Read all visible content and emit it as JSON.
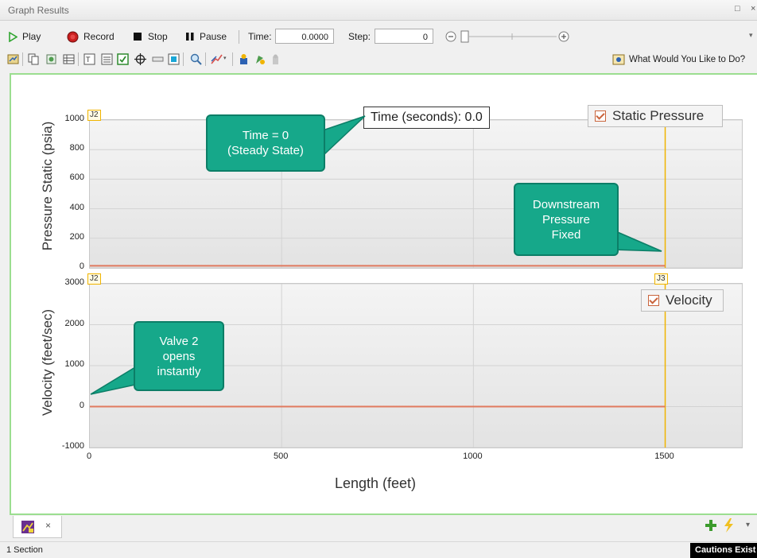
{
  "window": {
    "title": "Graph Results"
  },
  "player": {
    "play_label": "Play",
    "record_label": "Record",
    "stop_label": "Stop",
    "pause_label": "Pause",
    "time_label": "Time:",
    "time_value": "0.0000",
    "step_label": "Step:",
    "step_value": "0"
  },
  "toolbar2": {
    "help_label": "What Would You Like to Do?"
  },
  "graph": {
    "time_readout": "Time (seconds): 0.0",
    "callouts": {
      "steady_state": [
        "Time = 0",
        "(Steady State)"
      ],
      "downstream": [
        "Downstream",
        "Pressure",
        "Fixed"
      ],
      "valve": [
        "Valve 2",
        "opens",
        "instantly"
      ]
    },
    "junction_start": "J2",
    "junction_end": "J3"
  },
  "chart_data": [
    {
      "type": "line",
      "ylabel": "Pressure Static (psia)",
      "ylim": [
        0,
        1000
      ],
      "yticks": [
        "1000",
        "800",
        "600",
        "400",
        "200",
        "0"
      ],
      "xlim": [
        0,
        1700
      ],
      "series": [
        {
          "name": "Static Pressure",
          "x": [
            0,
            1500
          ],
          "y": [
            14,
            14
          ],
          "color": "#e07a5f"
        }
      ],
      "legend": "top-right",
      "grid": true
    },
    {
      "type": "line",
      "ylabel": "Velocity (feet/sec)",
      "xlabel": "Length (feet)",
      "ylim": [
        -1000,
        3000
      ],
      "yticks": [
        "3000",
        "2000",
        "1000",
        "0",
        "-1000"
      ],
      "xlim": [
        0,
        1700
      ],
      "xticks": [
        "0",
        "500",
        "1000",
        "1500"
      ],
      "series": [
        {
          "name": "Velocity",
          "x": [
            0,
            1500
          ],
          "y": [
            0,
            0
          ],
          "color": "#e07a5f"
        }
      ],
      "legend": "top-right",
      "grid": true
    }
  ],
  "status": {
    "sections": "1 Section",
    "cautions": "Cautions Exist"
  },
  "colors": {
    "accent_green": "#16a88a",
    "junction_line": "#f0b400",
    "series_line": "#e07a5f"
  }
}
